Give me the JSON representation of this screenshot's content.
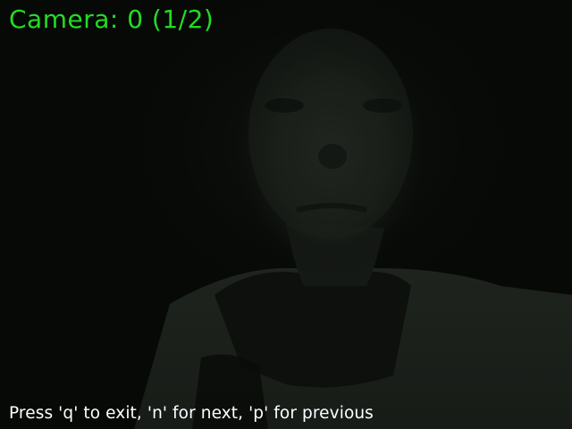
{
  "overlay": {
    "camera_label": "Camera: 0 (1/2)",
    "help_text": "Press 'q' to exit, 'n' for next, 'p' for previous"
  },
  "colors": {
    "camera_label": "#22dd22",
    "help_text": "#ffffff",
    "frame_background": "#060806"
  },
  "feed": {
    "content": "dim webcam image of a person's face"
  }
}
